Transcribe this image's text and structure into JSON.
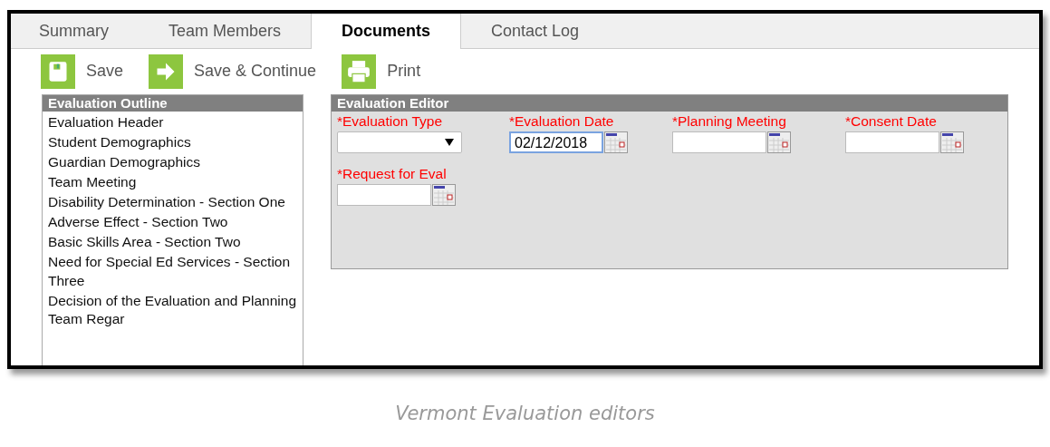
{
  "tabs": [
    {
      "label": "Summary",
      "selected": false
    },
    {
      "label": "Team Members",
      "selected": false
    },
    {
      "label": "Documents",
      "selected": true
    },
    {
      "label": "Contact Log",
      "selected": false
    }
  ],
  "toolbar": [
    {
      "kind": "save",
      "label": "Save"
    },
    {
      "kind": "continue",
      "label": "Save & Continue"
    },
    {
      "kind": "print",
      "label": "Print"
    }
  ],
  "outline": {
    "title": "Evaluation Outline",
    "items": [
      "Evaluation Header",
      "Student Demographics",
      "Guardian Demographics",
      "Team Meeting",
      "Disability Determination - Section One",
      "Adverse Effect - Section Two",
      "Basic Skills Area - Section Two",
      "Need for Special Ed Services - Section Three",
      "Decision of the Evaluation and Planning Team Regar"
    ]
  },
  "editor": {
    "title": "Evaluation Editor",
    "fields": [
      {
        "kind": "select",
        "label": "*Evaluation Type",
        "focused": false
      },
      {
        "kind": "date",
        "label": "*Evaluation Date",
        "value": "02/12/2018",
        "focused": true
      },
      {
        "kind": "date",
        "label": "*Planning Meeting",
        "focused": false
      },
      {
        "kind": "date",
        "label": "*Consent Date",
        "focused": false
      },
      {
        "kind": "date",
        "label": "*Request for Eval",
        "focused": false
      }
    ]
  },
  "caption": "Vermont Evaluation editors"
}
